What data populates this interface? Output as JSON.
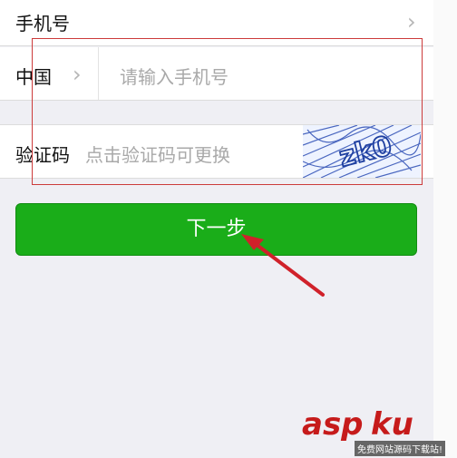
{
  "top_row": {
    "label": "手机号"
  },
  "phone_row": {
    "country": "中国",
    "placeholder": "请输入手机号"
  },
  "captcha_row": {
    "label": "验证码",
    "hint": "点击验证码可更换",
    "image_text": "zk0"
  },
  "next_button": {
    "label": "下一步"
  },
  "watermark": {
    "brand": "asp",
    "brand2": "ku",
    "tagline": "免费网站源码下载站!"
  },
  "colors": {
    "button_green": "#1aad19",
    "annotation_red": "#d0212a"
  }
}
